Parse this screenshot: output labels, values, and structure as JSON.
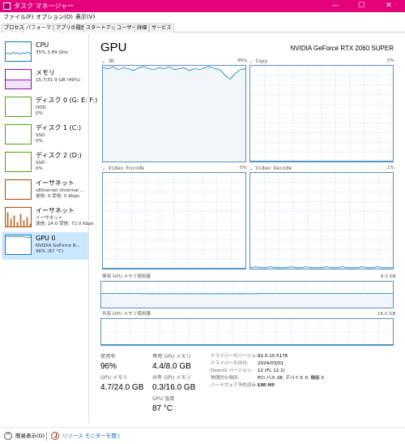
{
  "window": {
    "title": "タスク マネージャー",
    "minimize": "—",
    "maximize": "☐",
    "close": "✕"
  },
  "menu": [
    "ファイル(F)",
    "オプション(O)",
    "表示(V)"
  ],
  "tabs": [
    "プロセス",
    "パフォーマンス",
    "アプリの履歴",
    "スタートアップ",
    "ユーザー",
    "詳細",
    "サービス"
  ],
  "sidebar": {
    "items": [
      {
        "name": "CPU",
        "sub1": "35%  3.89 GHz",
        "sub2": "",
        "sub3": "",
        "color": "#117dbb"
      },
      {
        "name": "メモリ",
        "sub1": "15.7/31.9 GB (49%)",
        "sub2": "",
        "sub3": "",
        "color": "#8b12ae"
      },
      {
        "name": "ディスク 0 (G: E: F:)",
        "sub1": "HDD",
        "sub2": "0%",
        "sub3": "",
        "color": "#4da60c"
      },
      {
        "name": "ディスク 1 (C:)",
        "sub1": "SSD",
        "sub2": "0%",
        "sub3": "",
        "color": "#4da60c"
      },
      {
        "name": "ディスク 2 (D:)",
        "sub1": "SSD",
        "sub2": "0%",
        "sub3": "",
        "color": "#4da60c"
      },
      {
        "name": "イーサネット",
        "sub1": "vEthernet (Internal ...",
        "sub2": "送信: 0 受信: 0 Kbps",
        "sub3": "",
        "color": "#a74f01"
      },
      {
        "name": "イーサネット",
        "sub1": "イーサネット",
        "sub2": "送信: 24.0 受信: 72.0 Kbps",
        "sub3": "",
        "color": "#a74f01"
      },
      {
        "name": "GPU 0",
        "sub1": "NVIDIA GeForce R...",
        "sub2": "96% (87 °C)",
        "sub3": "",
        "color": "#117dbb"
      }
    ]
  },
  "main": {
    "title": "GPU",
    "model": "NVIDIA GeForce RTX 2060 SUPER",
    "graphs": {
      "g3d": {
        "label": "3D",
        "percent": "96%"
      },
      "copy": {
        "label": "Copy",
        "percent": "0%"
      },
      "encode": {
        "label": "Video Encode",
        "percent": "0%"
      },
      "decode": {
        "label": "Video Decode",
        "percent": "1%"
      }
    },
    "dedicated": {
      "label": "専用 GPU メモリ使用量",
      "max": "8.0 GB"
    },
    "shared": {
      "label": "共有 GPU メモリ使用量",
      "max": "16.0 GB"
    },
    "stats": {
      "utilization_label": "使用率",
      "utilization": "96%",
      "dedicated_label": "専用 GPU メモリ",
      "dedicated_value": "4.4/8.0 GB",
      "gpu_mem_label": "GPU メモリ",
      "gpu_mem_value": "4.7/24.0 GB",
      "shared_label": "共有 GPU メモリ",
      "shared_value": "0.3/16.0 GB",
      "temp_label": "GPU 温度",
      "temp_value": "87 °C"
    },
    "info": [
      {
        "key": "ドライバーのバージョン:",
        "value": "31.0.15.5176"
      },
      {
        "key": "ドライバーの日付:",
        "value": "2024/03/01"
      },
      {
        "key": "DirectX バージョン:",
        "value": "12 (FL 12.1)"
      },
      {
        "key": "物理的な場所:",
        "value": "PCI バス 38, デバイス 0, 機能 0"
      },
      {
        "key": "ハードウェア予約済みメモリ:",
        "value": "186 MB"
      }
    ]
  },
  "footer": {
    "fewer": "簡易表示(D)",
    "monitor": "リソース モニターを開く"
  },
  "chart_data": [
    {
      "type": "area",
      "title": "3D",
      "y": [
        98,
        97,
        99,
        96,
        98,
        97,
        95,
        98,
        99,
        97,
        96,
        98,
        97,
        99,
        96,
        97,
        98,
        95,
        97,
        96,
        98,
        99,
        97,
        96,
        90,
        86,
        92,
        96,
        97
      ],
      "ylim": [
        0,
        100
      ]
    },
    {
      "type": "area",
      "title": "Copy",
      "y": [
        0,
        0,
        0,
        0,
        0,
        0,
        0,
        0,
        0,
        0,
        0,
        0,
        0,
        0,
        0,
        0,
        0,
        0,
        0,
        0,
        0,
        0,
        0,
        0,
        0,
        0,
        0,
        0,
        0
      ],
      "ylim": [
        0,
        100
      ]
    },
    {
      "type": "area",
      "title": "Video Encode",
      "y": [
        0,
        0,
        0,
        0,
        0,
        0,
        0,
        0,
        0,
        0,
        0,
        0,
        0,
        0,
        0,
        0,
        0,
        0,
        0,
        0,
        0,
        0,
        0,
        0,
        0,
        0,
        0,
        0,
        0
      ],
      "ylim": [
        0,
        100
      ]
    },
    {
      "type": "area",
      "title": "Video Decode",
      "y": [
        1,
        2,
        1,
        1,
        2,
        1,
        1,
        1,
        2,
        1,
        1,
        2,
        1,
        1,
        1,
        2,
        1,
        1,
        2,
        1,
        1,
        1,
        2,
        1,
        1,
        2,
        1,
        1,
        1
      ],
      "ylim": [
        0,
        100
      ]
    },
    {
      "type": "area",
      "title": "専用 GPU メモリ使用量",
      "y": [
        4.4,
        4.4,
        4.4,
        4.4,
        4.3,
        4.3,
        4.3,
        4.3,
        4.3,
        4.3,
        4.3,
        4.3,
        4.3,
        4.3,
        4.3,
        4.3,
        4.4,
        4.4,
        4.4,
        4.4,
        4.4,
        4.4,
        4.4,
        4.4,
        4.4,
        4.4,
        4.4,
        4.4,
        4.4
      ],
      "ylim": [
        0,
        8.0
      ]
    },
    {
      "type": "area",
      "title": "共有 GPU メモリ使用量",
      "y": [
        0.3,
        0.3,
        0.3,
        0.3,
        0.3,
        0.3,
        0.3,
        0.3,
        0.3,
        0.3,
        0.3,
        0.3,
        0.3,
        0.3,
        0.3,
        0.3,
        0.3,
        0.3,
        0.3,
        0.3,
        0.3,
        0.3,
        0.3,
        0.3,
        0.3,
        0.3,
        0.3,
        0.3,
        0.3
      ],
      "ylim": [
        0,
        16.0
      ]
    }
  ]
}
